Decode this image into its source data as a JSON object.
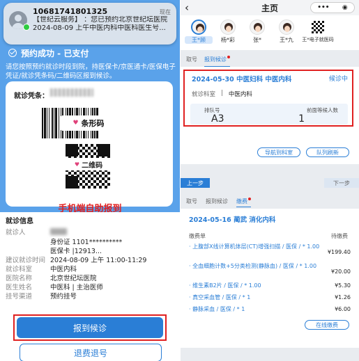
{
  "notification": {
    "from": "10681741801325",
    "time": "现在",
    "line1": "【世纪云服务】 ：您已预约北京世纪坛医院",
    "line2": "2024-08-09 上午中医内科中医科医生号..."
  },
  "left": {
    "status": "预约成功 - 已支付",
    "tip": "请您按照预约就诊时段到院，持医保卡/京医通卡/医保电子凭证/就诊凭条码/二维码区报到候诊。",
    "voucher_label": "就诊凭条：",
    "barcode_tag": "条形码",
    "qrcode_tag": "二维码",
    "self_report": "手机端自助报到",
    "info_title": "就诊信息",
    "rows": [
      {
        "k": "就诊人",
        "v": ""
      },
      {
        "k": "",
        "v": "身份证 1101**********"
      },
      {
        "k": "",
        "v": "医保卡 |12913..."
      },
      {
        "k": "建议就诊时间",
        "v": "2024-08-09 上午 11:00-11:29"
      },
      {
        "k": "就诊科室",
        "v": "中医内科"
      },
      {
        "k": "医院名称",
        "v": "北京世纪坛医院"
      },
      {
        "k": "医生姓名",
        "v": "中医科 | 主治医师"
      },
      {
        "k": "挂号渠道",
        "v": "预约挂号"
      }
    ],
    "report_button": "报到候诊",
    "refund_button": "退费退号"
  },
  "right": {
    "header_title": "主页",
    "back": "‹",
    "menu": "•••",
    "patients": [
      {
        "name": "王*顾",
        "selected": true
      },
      {
        "name": "杨*彩"
      },
      {
        "name": "张*"
      },
      {
        "name": "王*九"
      },
      {
        "name": "王*电子就医码",
        "qr": true
      }
    ],
    "tabs1": [
      "取号",
      "报到候诊"
    ],
    "visit": {
      "title": "2024-05-30 中医妇科 中医内科",
      "status": "候诊中",
      "dept_label": "就诊科室",
      "dept_value": "中医内科",
      "queue_label": "排队号",
      "queue_value": "A3",
      "waiting_label": "前面等候人数",
      "waiting_value": "1"
    },
    "nav_button": "导航到科室",
    "refresh_button": "队列刷新",
    "prev": "上一步",
    "next": "下一步",
    "tabs2": [
      "取号",
      "报到候诊",
      "缴费"
    ],
    "bill": {
      "title": "2024-05-16 蔺武 消化内科",
      "h1": "缴费单",
      "h2": "待缴费",
      "items": [
        {
          "text": "· 上腹部X线计算机体层(CT)增强扫描 / 医保 / * 1.00",
          "amt": "¥199.40"
        },
        {
          "text": "· 全血细胞计数+5分类检测(静脉血) / 医保 / * 1.00",
          "amt": "¥20.00"
        },
        {
          "text": "· 维生素B2片 / 医保 / * 1.00",
          "amt": "¥5.30"
        },
        {
          "text": "· 真空采血管 / 医保 / * 1",
          "amt": "¥1.26"
        },
        {
          "text": "· 静脉采血 / 医保 / * 1",
          "amt": "¥6.00"
        }
      ],
      "pay_button": "在线缴费"
    }
  }
}
